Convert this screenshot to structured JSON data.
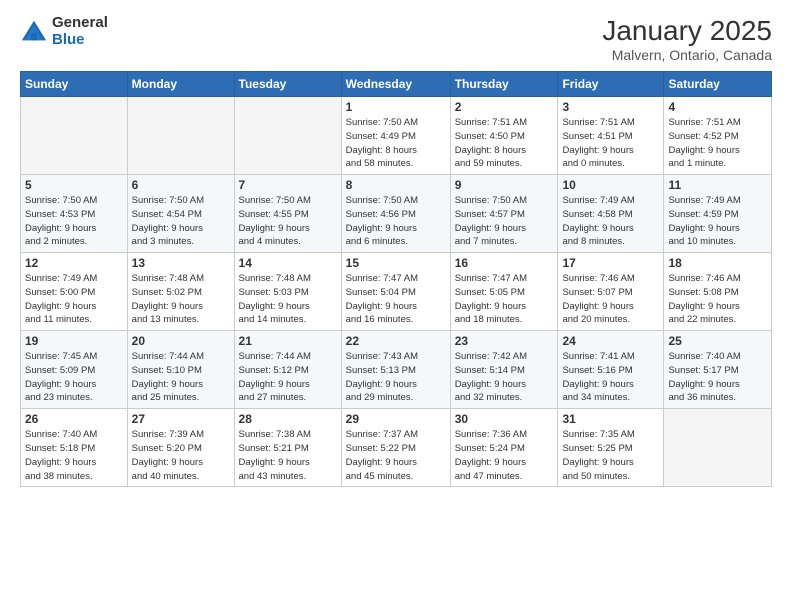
{
  "logo": {
    "general": "General",
    "blue": "Blue"
  },
  "title": {
    "main": "January 2025",
    "sub": "Malvern, Ontario, Canada"
  },
  "headers": [
    "Sunday",
    "Monday",
    "Tuesday",
    "Wednesday",
    "Thursday",
    "Friday",
    "Saturday"
  ],
  "weeks": [
    [
      {
        "num": "",
        "info": "",
        "empty": true
      },
      {
        "num": "",
        "info": "",
        "empty": true
      },
      {
        "num": "",
        "info": "",
        "empty": true
      },
      {
        "num": "1",
        "info": "Sunrise: 7:50 AM\nSunset: 4:49 PM\nDaylight: 8 hours\nand 58 minutes."
      },
      {
        "num": "2",
        "info": "Sunrise: 7:51 AM\nSunset: 4:50 PM\nDaylight: 8 hours\nand 59 minutes."
      },
      {
        "num": "3",
        "info": "Sunrise: 7:51 AM\nSunset: 4:51 PM\nDaylight: 9 hours\nand 0 minutes."
      },
      {
        "num": "4",
        "info": "Sunrise: 7:51 AM\nSunset: 4:52 PM\nDaylight: 9 hours\nand 1 minute."
      }
    ],
    [
      {
        "num": "5",
        "info": "Sunrise: 7:50 AM\nSunset: 4:53 PM\nDaylight: 9 hours\nand 2 minutes."
      },
      {
        "num": "6",
        "info": "Sunrise: 7:50 AM\nSunset: 4:54 PM\nDaylight: 9 hours\nand 3 minutes."
      },
      {
        "num": "7",
        "info": "Sunrise: 7:50 AM\nSunset: 4:55 PM\nDaylight: 9 hours\nand 4 minutes."
      },
      {
        "num": "8",
        "info": "Sunrise: 7:50 AM\nSunset: 4:56 PM\nDaylight: 9 hours\nand 6 minutes."
      },
      {
        "num": "9",
        "info": "Sunrise: 7:50 AM\nSunset: 4:57 PM\nDaylight: 9 hours\nand 7 minutes."
      },
      {
        "num": "10",
        "info": "Sunrise: 7:49 AM\nSunset: 4:58 PM\nDaylight: 9 hours\nand 8 minutes."
      },
      {
        "num": "11",
        "info": "Sunrise: 7:49 AM\nSunset: 4:59 PM\nDaylight: 9 hours\nand 10 minutes."
      }
    ],
    [
      {
        "num": "12",
        "info": "Sunrise: 7:49 AM\nSunset: 5:00 PM\nDaylight: 9 hours\nand 11 minutes."
      },
      {
        "num": "13",
        "info": "Sunrise: 7:48 AM\nSunset: 5:02 PM\nDaylight: 9 hours\nand 13 minutes."
      },
      {
        "num": "14",
        "info": "Sunrise: 7:48 AM\nSunset: 5:03 PM\nDaylight: 9 hours\nand 14 minutes."
      },
      {
        "num": "15",
        "info": "Sunrise: 7:47 AM\nSunset: 5:04 PM\nDaylight: 9 hours\nand 16 minutes."
      },
      {
        "num": "16",
        "info": "Sunrise: 7:47 AM\nSunset: 5:05 PM\nDaylight: 9 hours\nand 18 minutes."
      },
      {
        "num": "17",
        "info": "Sunrise: 7:46 AM\nSunset: 5:07 PM\nDaylight: 9 hours\nand 20 minutes."
      },
      {
        "num": "18",
        "info": "Sunrise: 7:46 AM\nSunset: 5:08 PM\nDaylight: 9 hours\nand 22 minutes."
      }
    ],
    [
      {
        "num": "19",
        "info": "Sunrise: 7:45 AM\nSunset: 5:09 PM\nDaylight: 9 hours\nand 23 minutes."
      },
      {
        "num": "20",
        "info": "Sunrise: 7:44 AM\nSunset: 5:10 PM\nDaylight: 9 hours\nand 25 minutes."
      },
      {
        "num": "21",
        "info": "Sunrise: 7:44 AM\nSunset: 5:12 PM\nDaylight: 9 hours\nand 27 minutes."
      },
      {
        "num": "22",
        "info": "Sunrise: 7:43 AM\nSunset: 5:13 PM\nDaylight: 9 hours\nand 29 minutes."
      },
      {
        "num": "23",
        "info": "Sunrise: 7:42 AM\nSunset: 5:14 PM\nDaylight: 9 hours\nand 32 minutes."
      },
      {
        "num": "24",
        "info": "Sunrise: 7:41 AM\nSunset: 5:16 PM\nDaylight: 9 hours\nand 34 minutes."
      },
      {
        "num": "25",
        "info": "Sunrise: 7:40 AM\nSunset: 5:17 PM\nDaylight: 9 hours\nand 36 minutes."
      }
    ],
    [
      {
        "num": "26",
        "info": "Sunrise: 7:40 AM\nSunset: 5:18 PM\nDaylight: 9 hours\nand 38 minutes."
      },
      {
        "num": "27",
        "info": "Sunrise: 7:39 AM\nSunset: 5:20 PM\nDaylight: 9 hours\nand 40 minutes."
      },
      {
        "num": "28",
        "info": "Sunrise: 7:38 AM\nSunset: 5:21 PM\nDaylight: 9 hours\nand 43 minutes."
      },
      {
        "num": "29",
        "info": "Sunrise: 7:37 AM\nSunset: 5:22 PM\nDaylight: 9 hours\nand 45 minutes."
      },
      {
        "num": "30",
        "info": "Sunrise: 7:36 AM\nSunset: 5:24 PM\nDaylight: 9 hours\nand 47 minutes."
      },
      {
        "num": "31",
        "info": "Sunrise: 7:35 AM\nSunset: 5:25 PM\nDaylight: 9 hours\nand 50 minutes."
      },
      {
        "num": "",
        "info": "",
        "empty": true
      }
    ]
  ]
}
